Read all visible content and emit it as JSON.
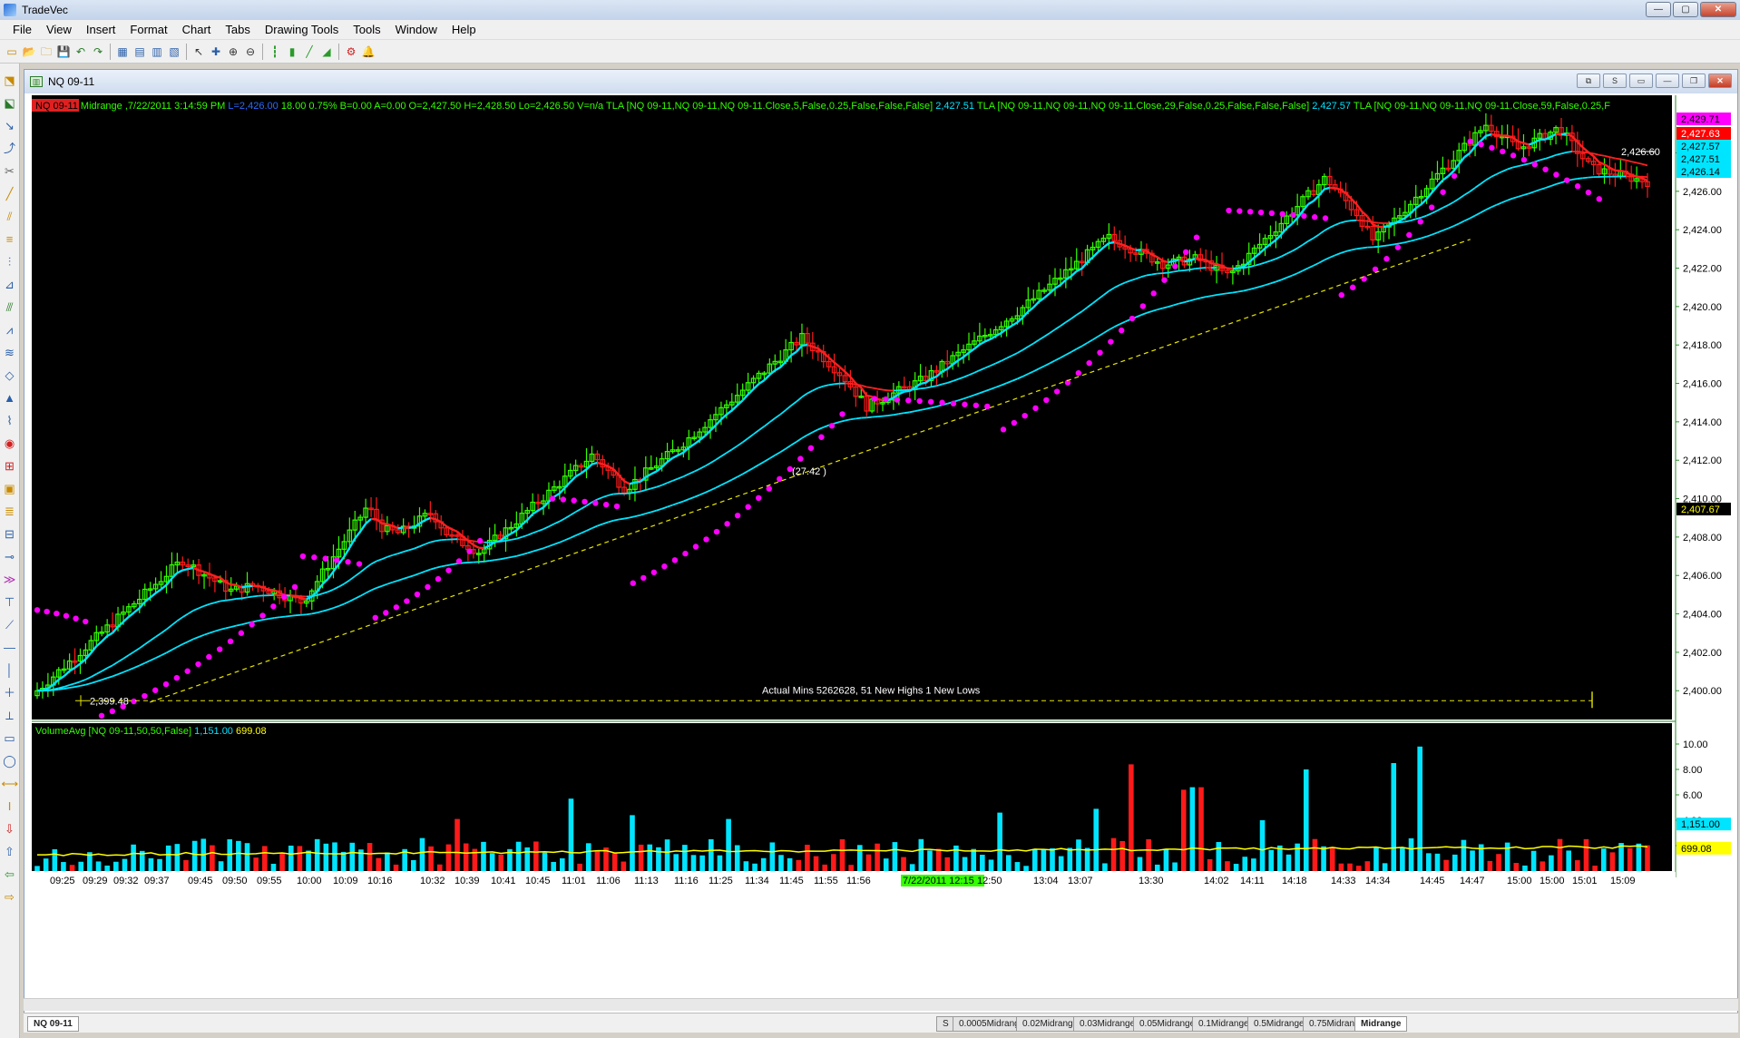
{
  "app": {
    "title": "TradeVec"
  },
  "window_buttons": {
    "minimize": "—",
    "maximize": "▢",
    "close": "✕"
  },
  "menu": [
    "File",
    "View",
    "Insert",
    "Format",
    "Chart",
    "Tabs",
    "Drawing Tools",
    "Tools",
    "Window",
    "Help"
  ],
  "toolbar_icons": [
    "new-icon",
    "open-icon",
    "folder-icon",
    "save-icon",
    "undo-icon",
    "redo-icon",
    "grid-icon",
    "layout-icon",
    "table-icon",
    "chart-icon",
    "arrow-icon",
    "crosshair-icon",
    "zoom-in-icon",
    "zoom-out-icon",
    "bar-icon",
    "candle-icon",
    "line-icon",
    "area-icon",
    "settings-icon",
    "alert-icon"
  ],
  "chart_window": {
    "title": "NQ 09-11",
    "tab_label": "NQ 09-11"
  },
  "header": {
    "symbol_badge": "NQ 09-11",
    "part1": "Midrange ,7/22/2011 3:14:59 PM",
    "part2": "L=2,426.00",
    "part3": "18.00 0.75% B=0.00 A=0.00 O=2,427.50 H=2,428.50 Lo=2,426.50 V=n/a",
    "tla1": "TLA [NQ 09-11,NQ 09-11,NQ 09-11.Close,5,False,0.25,False,False,False]",
    "tla1_val": "2,427.51",
    "tla2": "TLA [NQ 09-11,NQ 09-11,NQ 09-11.Close,29,False,0.25,False,False,False]",
    "tla2_val": "2,427.57",
    "tla3": "TLA [NQ 09-11,NQ 09-11,NQ 09-11.Close,59,False,0.25,F"
  },
  "price_axis": {
    "ticks": [
      "2,428.00",
      "2,426.00",
      "2,424.00",
      "2,422.00",
      "2,420.00",
      "2,418.00",
      "2,416.00",
      "2,414.00",
      "2,412.00",
      "2,410.00",
      "2,408.00",
      "2,406.00",
      "2,404.00",
      "2,402.00",
      "2,400.00"
    ],
    "markers": [
      {
        "text": "2,429.71",
        "bg": "#ff00ff",
        "fg": "#000000",
        "value": 2429.71
      },
      {
        "text": "2,427.63",
        "bg": "#ff0000",
        "fg": "#ffffff",
        "value": 2427.63
      },
      {
        "text": "2,427.57",
        "bg": "#00e5ff",
        "fg": "#000000",
        "value": 2427.57
      },
      {
        "text": "2,427.51",
        "bg": "#00e5ff",
        "fg": "#000000",
        "value": 2427.51
      },
      {
        "text": "2,426.14",
        "bg": "#00e5ff",
        "fg": "#000000",
        "value": 2426.14
      },
      {
        "text": "2,407.67",
        "bg": "#000000",
        "fg": "#ffff00",
        "value": 2407.67
      }
    ],
    "last_price_label": "2,426.60"
  },
  "annotations": {
    "trend_label": "(27.42 )",
    "low_label": "2,399.48",
    "summary": "Actual Mins 5262628, 51 New Highs 1 New Lows"
  },
  "volume": {
    "header_name": "VolumeAvg",
    "header_params": "[NQ 09-11,50,50,False]",
    "header_v1": "1,151.00",
    "header_v2": "699.08",
    "axis_ticks": [
      "10.00",
      "8.00",
      "6.00",
      "4.00",
      "2.00"
    ],
    "markers": [
      {
        "text": "1,151.00",
        "bg": "#00e5ff",
        "fg": "#000000"
      },
      {
        "text": "699.08",
        "bg": "#ffff00",
        "fg": "#000000"
      }
    ]
  },
  "time_axis": {
    "labels": [
      "09:25",
      "09:29",
      "09:32",
      "09:37",
      "09:45",
      "09:50",
      "09:55",
      "10:00",
      "10:09",
      "10:16",
      "10:32",
      "10:39",
      "10:41",
      "10:45",
      "11:01",
      "11:06",
      "11:13",
      "11:16",
      "11:25",
      "11:34",
      "11:45",
      "11:55",
      "11:56",
      "7/22/2011 12:15",
      "12:50",
      "13:04",
      "13:07",
      "13:30",
      "14:02",
      "14:11",
      "14:18",
      "14:33",
      "14:34",
      "14:45",
      "14:47",
      "15:00",
      "15:00",
      "15:01",
      "15:09"
    ]
  },
  "bottom_tabs": [
    "S",
    "0.0005Midrange",
    "0.02Midrange",
    "0.03Midrange",
    "0.05Midrange",
    "0.1Midrange",
    "0.5Midrange",
    "0.75Midrange",
    "Midrange"
  ],
  "colors": {
    "bg": "#000000",
    "up": "#33ff00",
    "down": "#ff1a1a",
    "ma": "#00e5ff",
    "maRed": "#ff2020",
    "sar": "#ff00ff",
    "trend": "#e6e600",
    "avgVol": "#ffff00"
  },
  "chart_data": {
    "type": "candlestick",
    "y_range": [
      2398.5,
      2431
    ],
    "volume_range": [
      0,
      10.5
    ],
    "path_anchors": [
      [
        0,
        2400
      ],
      [
        0.09,
        2406.8
      ],
      [
        0.12,
        2405.2
      ],
      [
        0.135,
        2405.5
      ],
      [
        0.165,
        2404.6
      ],
      [
        0.205,
        2409.6
      ],
      [
        0.215,
        2408.4
      ],
      [
        0.225,
        2408.2
      ],
      [
        0.245,
        2409.3
      ],
      [
        0.255,
        2408.1
      ],
      [
        0.275,
        2407.2
      ],
      [
        0.345,
        2412.3
      ],
      [
        0.365,
        2410.5
      ],
      [
        0.4,
        2412.8
      ],
      [
        0.475,
        2418.4
      ],
      [
        0.5,
        2416.4
      ],
      [
        0.515,
        2414.8
      ],
      [
        0.55,
        2416.2
      ],
      [
        0.61,
        2419.8
      ],
      [
        0.665,
        2423.6
      ],
      [
        0.7,
        2422.2
      ],
      [
        0.72,
        2422.5
      ],
      [
        0.74,
        2421.6
      ],
      [
        0.8,
        2426.7
      ],
      [
        0.82,
        2424.8
      ],
      [
        0.83,
        2423.4
      ],
      [
        0.9,
        2429.5
      ],
      [
        0.92,
        2428.2
      ],
      [
        0.945,
        2429.3
      ],
      [
        0.965,
        2427.2
      ],
      [
        1.0,
        2426.5
      ]
    ],
    "volume_spikes": [
      [
        0.26,
        4.1
      ],
      [
        0.33,
        5.7
      ],
      [
        0.37,
        4.4
      ],
      [
        0.43,
        4.1
      ],
      [
        0.6,
        4.6
      ],
      [
        0.66,
        4.9
      ],
      [
        0.68,
        8.4
      ],
      [
        0.71,
        6.4
      ],
      [
        0.72,
        6.6
      ],
      [
        0.76,
        4.0
      ],
      [
        0.79,
        8.0
      ],
      [
        0.84,
        8.5
      ],
      [
        0.86,
        9.8
      ]
    ],
    "sar_segments": [
      {
        "x": [
          0.0,
          0.03
        ],
        "y": [
          2404.2,
          2403.6
        ]
      },
      {
        "x": [
          0.04,
          0.16
        ],
        "y": [
          2398.7,
          2405.4
        ]
      },
      {
        "x": [
          0.165,
          0.2
        ],
        "y": [
          2407.0,
          2406.6
        ]
      },
      {
        "x": [
          0.21,
          0.275
        ],
        "y": [
          2403.8,
          2407.8
        ]
      },
      {
        "x": [
          0.32,
          0.36
        ],
        "y": [
          2410.0,
          2409.6
        ]
      },
      {
        "x": [
          0.37,
          0.5
        ],
        "y": [
          2405.6,
          2414.4
        ]
      },
      {
        "x": [
          0.52,
          0.59
        ],
        "y": [
          2415.2,
          2414.8
        ]
      },
      {
        "x": [
          0.6,
          0.72
        ],
        "y": [
          2413.6,
          2423.6
        ]
      },
      {
        "x": [
          0.74,
          0.8
        ],
        "y": [
          2425.0,
          2424.6
        ]
      },
      {
        "x": [
          0.81,
          0.88
        ],
        "y": [
          2420.6,
          2426.8
        ]
      },
      {
        "x": [
          0.89,
          0.97
        ],
        "y": [
          2428.6,
          2425.6
        ]
      },
      {
        "x": [
          1.02,
          1.1
        ],
        "y": [
          2423.6,
          2426.2
        ]
      },
      {
        "x": [
          1.12,
          1.2
        ],
        "y": [
          2429.4,
          2429.2
        ]
      }
    ],
    "trend_line": {
      "from": [
        0.07,
        2399.4
      ],
      "to": [
        0.89,
        2423.5
      ],
      "label": "(27.42 )"
    },
    "low_line": {
      "y": 2399.48
    }
  }
}
